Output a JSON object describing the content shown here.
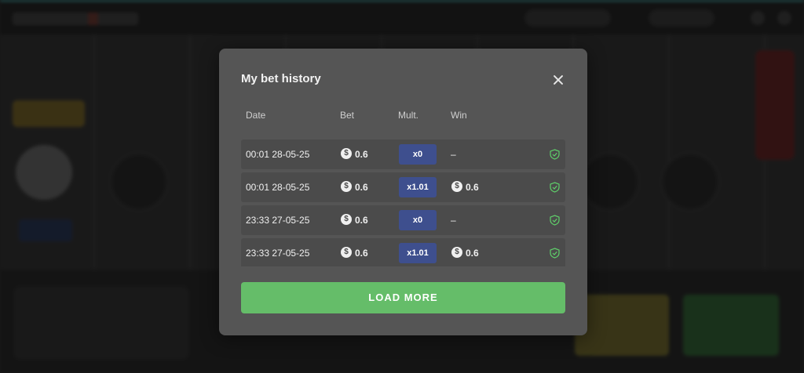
{
  "modal": {
    "title": "My bet history",
    "close_icon": "close-icon",
    "columns": {
      "date": "Date",
      "bet": "Bet",
      "mult": "Mult.",
      "win": "Win"
    },
    "coin_glyph": "$",
    "rows": [
      {
        "date": "00:01 28-05-25",
        "bet": "0.6",
        "mult": "x0",
        "win": "–"
      },
      {
        "date": "00:01 28-05-25",
        "bet": "0.6",
        "mult": "x1.01",
        "win": "0.6"
      },
      {
        "date": "23:33 27-05-25",
        "bet": "0.6",
        "mult": "x0",
        "win": "–"
      },
      {
        "date": "23:33 27-05-25",
        "bet": "0.6",
        "mult": "x1.01",
        "win": "0.6"
      }
    ],
    "load_more_label": "LOAD MORE"
  },
  "colors": {
    "modal_bg": "#555555",
    "row_bg": "#4b4b4b",
    "mult_badge": "#3e4f8e",
    "load_more": "#65bd69",
    "shield_icon": "#5fcf6a"
  }
}
